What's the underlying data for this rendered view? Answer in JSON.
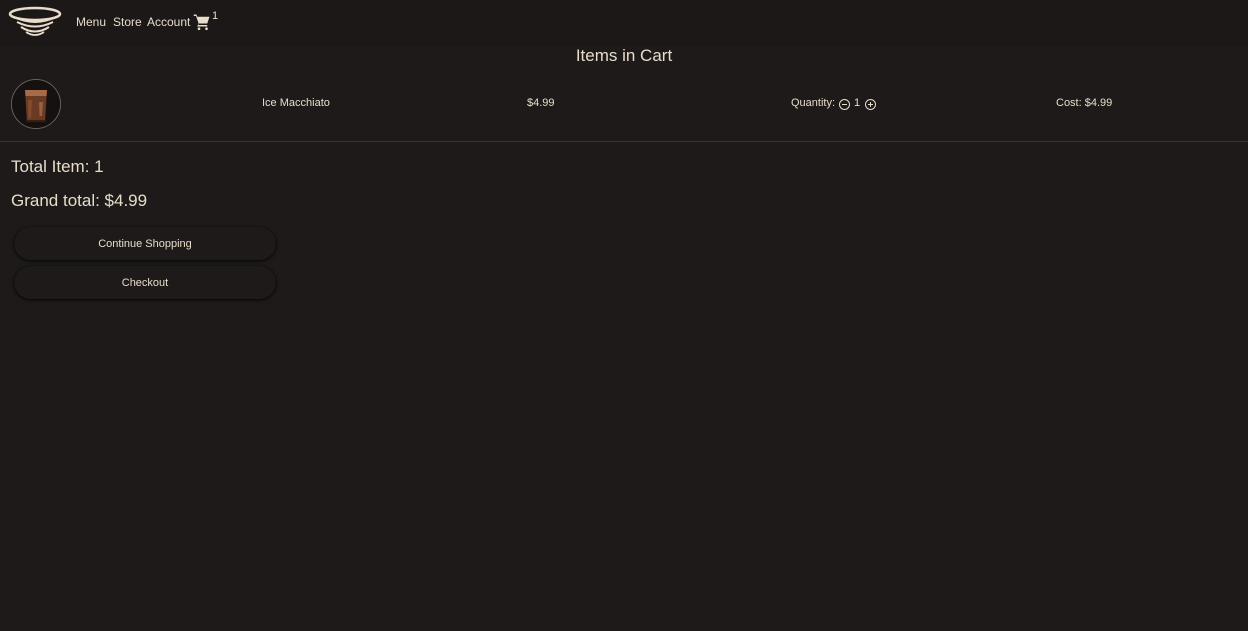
{
  "nav": {
    "links": [
      "Menu",
      "Store",
      "Account"
    ],
    "cart_count": "1"
  },
  "page_title": "Items in Cart",
  "cart_items": [
    {
      "name": "Ice Macchiato",
      "price": "$4.99",
      "quantity_label": "Quantity:",
      "quantity": "1",
      "cost": "Cost: $4.99"
    }
  ],
  "summary": {
    "total_items": "Total Item: 1",
    "grand_total": "Grand total: $4.99"
  },
  "buttons": {
    "continue_label": "Continue Shopping",
    "checkout_label": "Checkout"
  },
  "colors": {
    "background": "#1d1a19",
    "text": "#e8dccb"
  }
}
